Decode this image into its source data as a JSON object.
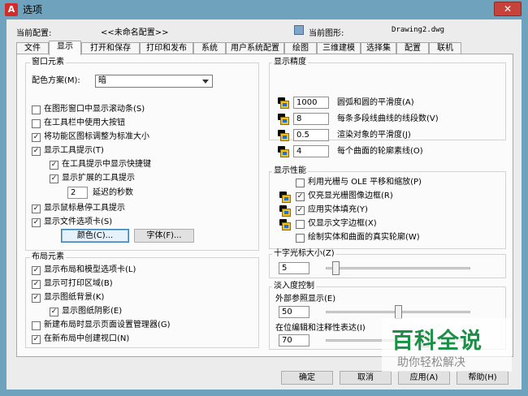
{
  "window": {
    "title": "选项",
    "close_glyph": "✕"
  },
  "header": {
    "profile_label": "当前配置:",
    "profile_value": "<<未命名配置>>",
    "drawing_label": "当前图形:",
    "drawing_value": "Drawing2.dwg"
  },
  "tabs": [
    "文件",
    "显示",
    "打开和保存",
    "打印和发布",
    "系统",
    "用户系统配置",
    "绘图",
    "三维建模",
    "选择集",
    "配置",
    "联机"
  ],
  "active_tab": "显示",
  "window_elements": {
    "title": "窗口元素",
    "color_scheme_label": "配色方案(M):",
    "color_scheme_value": "暗",
    "options": [
      {
        "label": "在图形窗口中显示滚动条(S)",
        "checked": false
      },
      {
        "label": "在工具栏中使用大按钮",
        "checked": false
      },
      {
        "label": "将功能区图标调整为标准大小",
        "checked": true
      },
      {
        "label": "显示工具提示(T)",
        "checked": true
      },
      {
        "label": "在工具提示中显示快捷键",
        "checked": true
      },
      {
        "label": "显示扩展的工具提示",
        "checked": true
      },
      {
        "label": "显示鼠标悬停工具提示",
        "checked": true
      },
      {
        "label": "显示文件选项卡(S)",
        "checked": true
      }
    ],
    "delay_value": "2",
    "delay_label": "延迟的秒数",
    "colors_button": "颜色(C)...",
    "fonts_button": "字体(F)..."
  },
  "layout_elements": {
    "title": "布局元素",
    "options": [
      {
        "label": "显示布局和模型选项卡(L)",
        "checked": true
      },
      {
        "label": "显示可打印区域(B)",
        "checked": true
      },
      {
        "label": "显示图纸背景(K)",
        "checked": true
      },
      {
        "label": "显示图纸阴影(E)",
        "checked": true
      },
      {
        "label": "新建布局时显示页面设置管理器(G)",
        "checked": false
      },
      {
        "label": "在新布局中创建视口(N)",
        "checked": true
      }
    ]
  },
  "display_resolution": {
    "title": "显示精度",
    "items": [
      {
        "value": "1000",
        "label": "圆弧和圆的平滑度(A)",
        "icon": "saved-in-drawing-icon"
      },
      {
        "value": "8",
        "label": "每条多段线曲线的线段数(V)",
        "icon": "saved-in-drawing-icon"
      },
      {
        "value": "0.5",
        "label": "渲染对象的平滑度(J)",
        "icon": "saved-in-drawing-icon"
      },
      {
        "value": "4",
        "label": "每个曲面的轮廓素线(O)",
        "icon": "saved-in-drawing-icon"
      }
    ]
  },
  "display_performance": {
    "title": "显示性能",
    "options": [
      {
        "label": "利用光栅与 OLE 平移和缩放(P)",
        "checked": false,
        "icon": false
      },
      {
        "label": "仅亮显光栅图像边框(R)",
        "checked": true,
        "icon": true
      },
      {
        "label": "应用实体填充(Y)",
        "checked": true,
        "icon": true
      },
      {
        "label": "仅显示文字边框(X)",
        "checked": false,
        "icon": true
      },
      {
        "label": "绘制实体和曲面的真实轮廓(W)",
        "checked": false,
        "icon": false
      }
    ]
  },
  "crosshair": {
    "title": "十字光标大小(Z)",
    "value": "5",
    "slider_fraction": 0.05
  },
  "fade_control": {
    "title": "淡入度控制",
    "xref_label": "外部参照显示(E)",
    "xref_value": "50",
    "xref_fraction": 0.5,
    "inplace_label": "在位编辑和注释性表达(I)",
    "inplace_value": "70",
    "inplace_fraction": 0.7
  },
  "footer": {
    "ok": "确定",
    "cancel": "取消",
    "apply": "应用(A)",
    "help": "帮助(H)"
  },
  "watermark": {
    "title": "百科全说",
    "subtitle": "助你轻松解决"
  }
}
